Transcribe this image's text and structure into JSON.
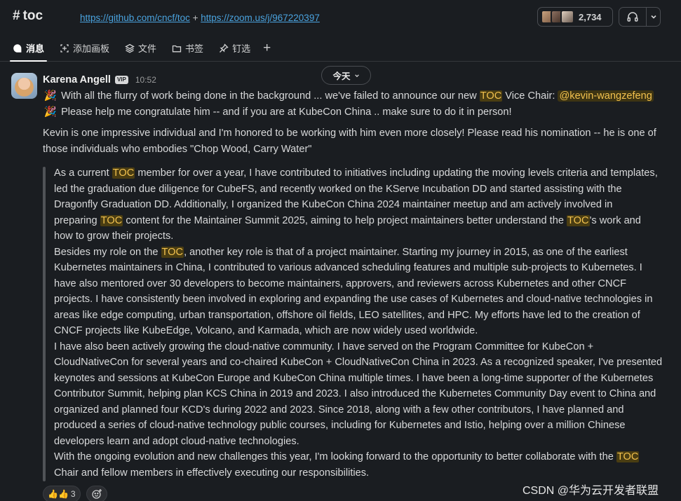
{
  "header": {
    "channel": "toc",
    "topic_link_1": "https://github.com/cncf/toc",
    "topic_sep": " + ",
    "topic_link_2": "https://zoom.us/j/967220397",
    "member_count": "2,734"
  },
  "tabs": [
    {
      "label": "消息",
      "icon": "message-icon"
    },
    {
      "label": "添加画板",
      "icon": "canvas-icon"
    },
    {
      "label": "文件",
      "icon": "files-icon"
    },
    {
      "label": "书签",
      "icon": "bookmark-icon"
    },
    {
      "label": "钉选",
      "icon": "pin-icon"
    }
  ],
  "date_pill": "今天",
  "message": {
    "author": "Karena Angell",
    "badge": "VIP",
    "time": "10:52",
    "intro": [
      {
        "pre": "With all the flurry of work being done in the background ... we've failed to announce our new ",
        "hl": "TOC",
        "post": " Vice Chair: ",
        "mention": "@kevin-wangzefeng"
      },
      {
        "pre": "Please help me congratulate him -- and if you are at KubeCon China .. make sure to do it in person!"
      }
    ],
    "para2": [
      "Kevin is one impressive individual and I'm honored to be working with him even more closely! Please read his nomination -- he is one of",
      "those individuals who embodies \"Chop Wood, Carry Water\""
    ],
    "quote": [
      {
        "pre": "As a current ",
        "hl": "TOC",
        "post": " member for over a year, I have contributed to initiatives including updating the moving levels criteria and templates,"
      },
      {
        "pre": "led the graduation due diligence for CubeFS, and recently worked on the KServe Incubation DD and started assisting with the"
      },
      {
        "pre": "Dragonfly Graduation DD. Additionally, I organized the KubeCon China 2024 maintainer meetup and am actively involved in"
      },
      {
        "pre": "preparing ",
        "hl": "TOC",
        "post": " content for the Maintainer Summit 2025, aiming to help project maintainers better understand the ",
        "hl2": "TOC",
        "post2": "'s work and"
      },
      {
        "pre": "how to grow their projects."
      },
      {
        "pre": "Besides my role on the ",
        "hl": "TOC",
        "post": ", another key role is that of a project maintainer. Starting my journey in 2015, as one of the earliest"
      },
      {
        "pre": "Kubernetes maintainers in China, I contributed to various advanced scheduling features and multiple sub-projects to Kubernetes. I"
      },
      {
        "pre": "have also mentored over 30 developers to become maintainers, approvers, and reviewers across Kubernetes and other CNCF"
      },
      {
        "pre": "projects. I have consistently been involved in exploring and expanding the use cases of Kubernetes and cloud-native technologies in"
      },
      {
        "pre": "areas like edge computing, urban transportation, offshore oil fields, LEO satellites, and HPC. My efforts have led to the creation of"
      },
      {
        "pre": "CNCF projects like KubeEdge, Volcano, and Karmada, which are now widely used worldwide."
      },
      {
        "pre": "I have also been actively growing the cloud-native community. I have served on the Program Committee for KubeCon +"
      },
      {
        "pre": "CloudNativeCon for several years and co-chaired KubeCon + CloudNativeCon China in 2023. As a recognized speaker, I've presented"
      },
      {
        "pre": "keynotes and sessions at KubeCon Europe and KubeCon China multiple times. I have been a long-time supporter of the Kubernetes"
      },
      {
        "pre": "Contributor Summit, helping plan KCS China in 2019 and 2023. I also introduced the Kubernetes Community Day event to China and"
      },
      {
        "pre": "organized and planned four KCD's during 2022 and 2023. Since 2018, along with a few other contributors, I have planned and"
      },
      {
        "pre": "produced a series of cloud-native technology public courses, including for Kubernetes and Istio, helping over a million Chinese"
      },
      {
        "pre": "developers learn and adopt cloud-native technologies."
      },
      {
        "pre": "With the ongoing evolution and new challenges this year, I'm looking forward to the opportunity to better collaborate with the ",
        "hl": "TOC"
      },
      {
        "pre": "Chair and fellow members in effectively executing our responsibilities."
      }
    ],
    "reaction": {
      "emoji": "👍👍",
      "count": "3"
    }
  },
  "watermark": "CSDN @华为云开发者联盟",
  "colors": {
    "background": "#1a1d21",
    "highlight": "#f2c14e",
    "link": "#4aa3df"
  }
}
